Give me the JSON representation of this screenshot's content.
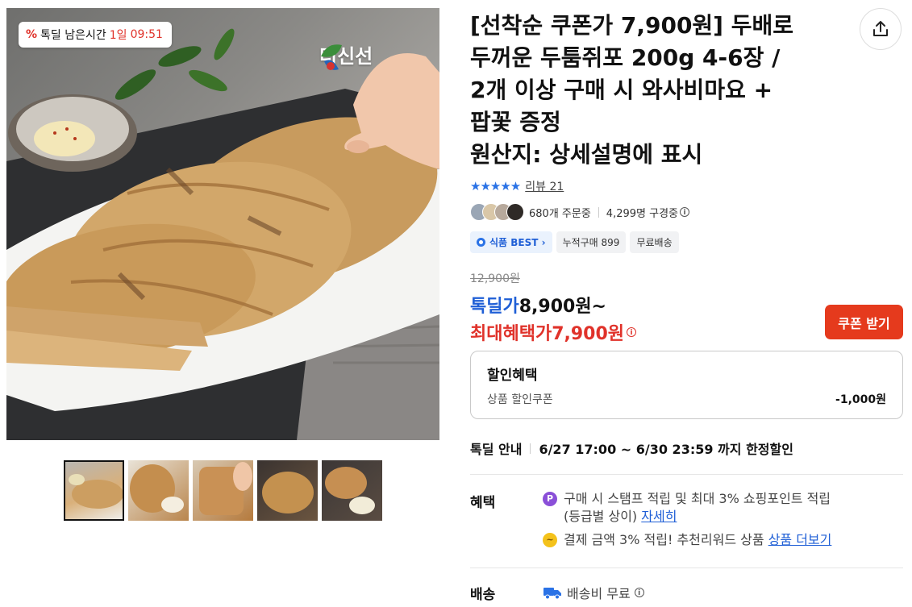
{
  "timer": {
    "label": "톡딜 남은시간",
    "days": "1일",
    "time": "09:51"
  },
  "brand": {
    "name": "더신선"
  },
  "thumbnails": [
    "thumb-1",
    "thumb-2",
    "thumb-3",
    "thumb-4",
    "thumb-5"
  ],
  "product": {
    "title_lines": [
      "[선착순 쿠폰가 7,900원] 두배로",
      "두꺼운 두툼쥐포 200g 4-6장 /",
      "2개 이상 구매 시 와사비마요 +",
      "팝꽃 증정",
      "원산지: 상세설명에 표시"
    ]
  },
  "rating": {
    "stars": "★★★★★",
    "review_link": "리뷰 21"
  },
  "social": {
    "ordering": "680개 주문중",
    "watching": "4,299명 구경중"
  },
  "badges": {
    "food_best": "식품 BEST",
    "cumulative": "누적구매 899",
    "free_shipping": "무료배송"
  },
  "price": {
    "original": "12,900원",
    "deal_label": "톡딜가",
    "deal_value": "8,900원~",
    "max_label": "최대혜택가",
    "max_value": "7,900원"
  },
  "coupon_button": "쿠폰 받기",
  "discount": {
    "heading": "할인혜택",
    "item": "상품 할인쿠폰",
    "amount": "-1,000원"
  },
  "deal_period": {
    "label": "톡딜 안내",
    "text": "6/27 17:00 ~ 6/30 23:59 까지 한정할인"
  },
  "benefits": {
    "label": "혜택",
    "item1_text": "구매 시 스탬프 적립 및 최대 3% 쇼핑포인트 적립",
    "item1_sub": "(등급별 상이)",
    "item1_link": "자세히",
    "item2_text": "결제 금액 3% 적립! 추천리워드 상품",
    "item2_link": "상품 더보기"
  },
  "shipping": {
    "label": "배송",
    "text": "배송비 무료"
  },
  "colors": {
    "accent_red": "#e53a1d",
    "accent_blue": "#1f5fd6",
    "star_blue": "#2a72e6"
  },
  "icons": {
    "timer": "discount-percent-icon",
    "share": "share-icon",
    "benefit1": "point-p-icon",
    "benefit2": "reward-coin-icon",
    "shipping": "truck-icon"
  }
}
